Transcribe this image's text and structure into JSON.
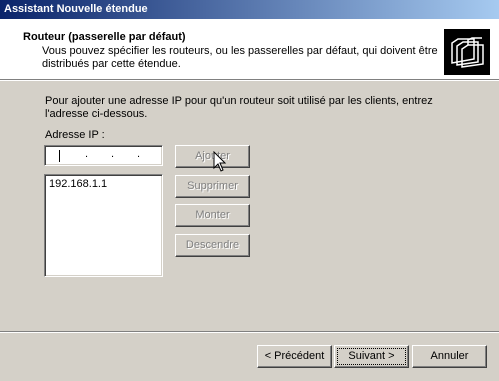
{
  "window": {
    "title": "Assistant Nouvelle étendue"
  },
  "header": {
    "title": "Routeur (passerelle par défaut)",
    "description": "Vous pouvez spécifier les routeurs, ou les passerelles par défaut, qui doivent être distribués par cette étendue.",
    "icon": "folders-icon"
  },
  "main": {
    "instructions": "Pour ajouter une adresse IP pour qu'un routeur soit utilisé par les clients, entrez l'adresse ci-dessous.",
    "ip_label": "Adresse IP :",
    "ip_input_value": ".  .  .",
    "router_list": [
      "192.168.1.1"
    ],
    "buttons": {
      "add": "Ajouter",
      "remove": "Supprimer",
      "up": "Monter",
      "down": "Descendre"
    }
  },
  "footer": {
    "prev": "< Précédent",
    "next": "Suivant >",
    "cancel": "Annuler"
  }
}
